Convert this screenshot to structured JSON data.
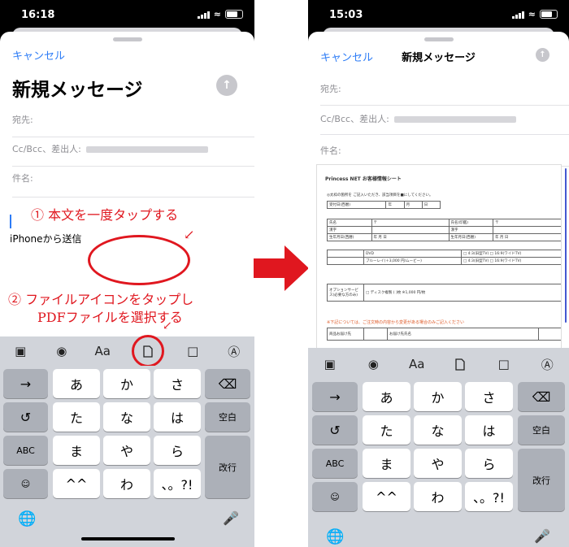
{
  "left": {
    "status": {
      "time": "16:18"
    },
    "cancel": "キャンセル",
    "title": "新規メッセージ",
    "fields": {
      "to": "宛先:",
      "cc": "Cc/Bcc、差出人:",
      "subject": "件名:"
    },
    "body": "iPhoneから送信",
    "annotations": {
      "step1": "① 本文を一度タップする",
      "step2_line1": "② ファイルアイコンをタップし",
      "step2_line2": "PDFファイルを選択する"
    }
  },
  "right": {
    "status": {
      "time": "15:03"
    },
    "cancel": "キャンセル",
    "title": "新規メッセージ",
    "fields": {
      "to": "宛先:",
      "cc": "Cc/Bcc、差出人:",
      "subject": "件名:"
    },
    "pdf": {
      "title": "Princess NET お客様情報シート",
      "note": "◎太枠の箇所を ご記入いただき、該当項目を■にしてください。",
      "rows": [
        [
          "受付日(西暦)",
          "年",
          "月",
          "日"
        ],
        [
          "氏名",
          "〒",
          "氏名(印鑑)",
          "〒"
        ],
        [
          "漢字",
          "",
          "漢字",
          ""
        ],
        [
          "生年月日(西暦)",
          "年 月 日",
          "生年月日(西暦)",
          "年 月 日"
        ]
      ],
      "dvd": "DVD",
      "dvd_opts": "□ 4:3(旧型TV) □ 16:9(ワイドTV)",
      "bluray": "ブルーレイ(＋3,000 円/ムービー)",
      "bluray_opts": "□ 4:3(旧型TV) □ 16:9(ワイドTV)",
      "option": "オプションサービス(必要な方のみ)",
      "option_item": "□ ディスク複製 ( )枚 ※1,000 円/枚",
      "footer": "※下記については、ご注文時の内容から変更がある場合のみご記入ください",
      "goods": "商品お届け先",
      "reorder": "お届け先氏名"
    }
  },
  "toolbar_icons": [
    "photo-icon",
    "camera-icon",
    "Aa",
    "file-icon",
    "scan-icon",
    "markup-icon"
  ],
  "keyboard": {
    "row1": [
      "→",
      "あ",
      "か",
      "さ",
      "⌫"
    ],
    "row2": [
      "↺",
      "た",
      "な",
      "は",
      "空白"
    ],
    "row3": [
      "ABC",
      "ま",
      "や",
      "ら",
      "改行"
    ],
    "row4": [
      "☺",
      "^^",
      "わ",
      "、。?!"
    ],
    "globe": "globe-icon",
    "mic": "mic-icon"
  },
  "colors": {
    "accent": "#2d7cf6",
    "annotation": "#e0171f"
  }
}
